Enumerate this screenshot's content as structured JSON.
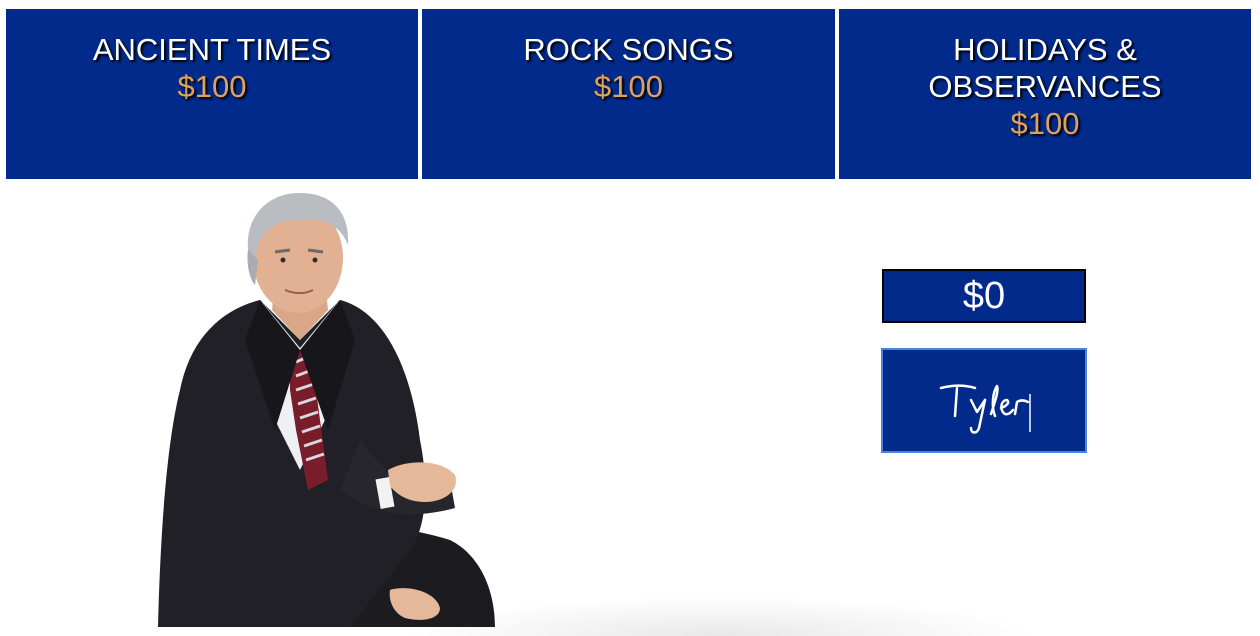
{
  "board": {
    "categories": [
      {
        "title": "ANCIENT TIMES",
        "value": "$100"
      },
      {
        "title": "ROCK SONGS",
        "value": "$100"
      },
      {
        "title": "HOLIDAYS & OBSERVANCES",
        "value": "$100"
      }
    ]
  },
  "player": {
    "score": "$0",
    "name": "Tyler"
  },
  "colors": {
    "board_blue": "#012a8b",
    "dollar_gold": "#e0a15a",
    "focus_border": "#4a84dc"
  },
  "icons": {
    "host": "host-portrait-icon"
  }
}
